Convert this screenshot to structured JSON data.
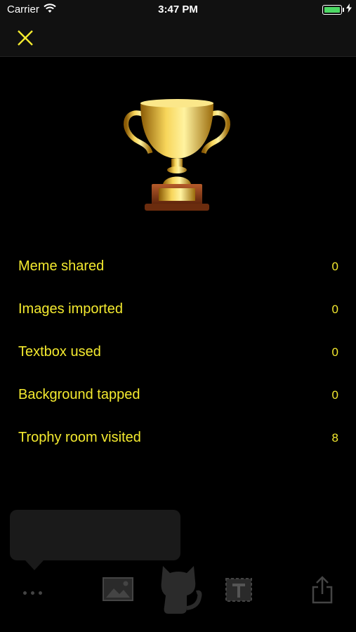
{
  "status_bar": {
    "carrier": "Carrier",
    "time": "3:47 PM"
  },
  "colors": {
    "accent": "#f4ea2f",
    "background": "#000000",
    "bar": "#111111",
    "battery": "#4cd964"
  },
  "nav": {
    "close_icon": "close-x-icon"
  },
  "stats": [
    {
      "label": "Meme shared",
      "value": "0"
    },
    {
      "label": "Images imported",
      "value": "0"
    },
    {
      "label": "Textbox used",
      "value": "0"
    },
    {
      "label": "Background tapped",
      "value": "0"
    },
    {
      "label": "Trophy room visited",
      "value": "8"
    }
  ],
  "toolbar": {
    "icons": [
      "more-icon",
      "image-icon",
      "cat-icon",
      "text-icon",
      "share-icon"
    ]
  }
}
